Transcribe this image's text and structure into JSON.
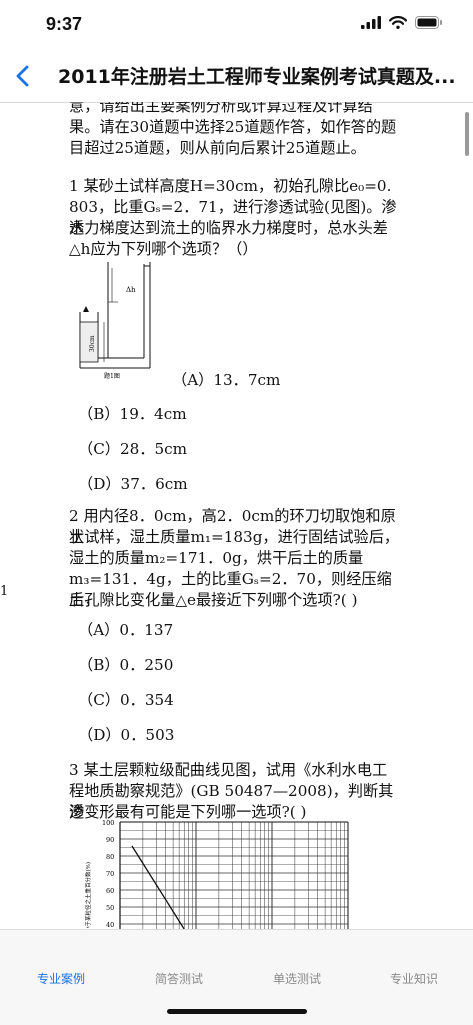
{
  "status": {
    "time": "9:37"
  },
  "nav": {
    "title": "2011年注册岩土工程师专业案例考试真题及..."
  },
  "intro": {
    "line1": "意，请给出主要案例分析或计算过程及计算结",
    "line2": "果。请在30道题中选择25道题作答，如作答的题",
    "line3": "目超过25道题，则从前向后累计25道题止。"
  },
  "q1": {
    "line1": "1 某砂土试样高度H=30cm，初始孔隙比e₀=0.",
    "line2": "803，比重Gₛ=2．71，进行渗透试验(见图)。渗透",
    "line3": "水力梯度达到流土的临界水力梯度时，总水头差",
    "line4": "△h应为下列哪个选项？（）",
    "figure_caption": "题1图",
    "figure_dim": "30cm",
    "figure_delta": "Δh",
    "options": [
      "（A）13．7cm",
      "（B）19．4cm",
      "（C）28．5cm",
      "（D）37．6cm"
    ]
  },
  "q2": {
    "line1": "2 用内径8．0cm，高2．0cm的环刀切取饱和原状",
    "line2": "土试样，湿土质量m₁=183g，进行固结试验后，",
    "line3": "湿土的质量m₂=171．0g，烘干后土的质量",
    "line4": "m₃=131．4g，土的比重Gₛ=2．70，则经压缩后，",
    "line5": "土孔隙比变化量△e最接近下列哪个选项?( )",
    "options": [
      "（A）0．137",
      "（B）0．250",
      "（C）0．354",
      "（D）0．503"
    ]
  },
  "side_number": "1",
  "q3": {
    "line1": "3 某土层颗粒级配曲线见图，试用《水利水电工",
    "line2": "程地质勘察规范》(GB 50487—2008)，判断其渗",
    "line3": "透变形最有可能是下列哪一选项?( )",
    "y_ticks": [
      "100",
      "90",
      "80",
      "70",
      "60",
      "50",
      "40"
    ],
    "y_label": "小于某粒径之土重百分数(%)"
  },
  "tabs": [
    {
      "label": "专业案例",
      "active": true
    },
    {
      "label": "简答测试",
      "active": false
    },
    {
      "label": "单选测试",
      "active": false
    },
    {
      "label": "专业知识",
      "active": false
    }
  ],
  "colors": {
    "accent": "#1a73e8",
    "inactive": "#8a8a8a"
  }
}
